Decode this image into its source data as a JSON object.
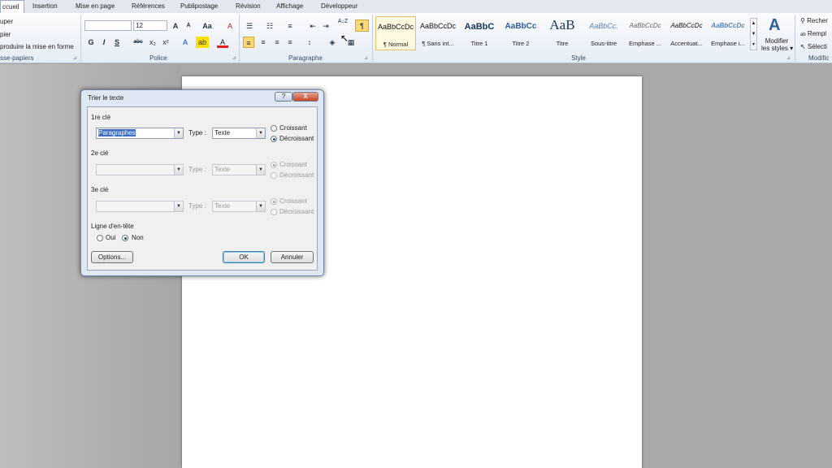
{
  "tabs": [
    "ccueil",
    "Insertion",
    "Mise en page",
    "Références",
    "Publipostage",
    "Révision",
    "Affichage",
    "Développeur"
  ],
  "clipboard": {
    "items": [
      "uper",
      "pier",
      "produire la mise en forme"
    ],
    "label": "sse-papiers"
  },
  "font": {
    "name_value": "",
    "size_value": "12",
    "grow": "A",
    "shrink": "A",
    "case": "Aa",
    "clear": "A",
    "bold": "G",
    "italic": "I",
    "underline": "S",
    "strike": "abc",
    "sub": "x₂",
    "sup": "x²",
    "effects": "A",
    "highlight": "ab",
    "color": "A",
    "label": "Police"
  },
  "paragraph": {
    "label": "Paragraphe",
    "sort": "A↓Z",
    "show_marks": "¶"
  },
  "styles": {
    "label": "Style",
    "items": [
      {
        "sample": "AaBbCcDc",
        "name": "¶ Normal"
      },
      {
        "sample": "AaBbCcDc",
        "name": "¶ Sans int..."
      },
      {
        "sample": "AaBbC",
        "name": "Titre 1"
      },
      {
        "sample": "AaBbCc",
        "name": "Titre 2"
      },
      {
        "sample": "AaB",
        "name": "Titre"
      },
      {
        "sample": "AaBbCc.",
        "name": "Sous-titre"
      },
      {
        "sample": "AaBbCcDc",
        "name": "Emphase ..."
      },
      {
        "sample": "AaBbCcDc",
        "name": "Accentuat..."
      },
      {
        "sample": "AaBbCcDc",
        "name": "Emphase i..."
      }
    ],
    "modify_line1": "Modifier",
    "modify_line2": "les styles ▾"
  },
  "editing": {
    "find": "Recher",
    "replace": "Rempl",
    "select": "Sélecti",
    "label": "Modific"
  },
  "dialog": {
    "title": "Trier le texte",
    "help": "?",
    "close": "X",
    "key1": {
      "label": "1re clé",
      "field": "Paragraphes",
      "type_label": "Type :",
      "type_value": "Texte",
      "asc": "Croissant",
      "desc": "Décroissant"
    },
    "key2": {
      "label": "2e clé",
      "field": "",
      "type_label": "Type :",
      "type_value": "Texte",
      "asc": "Croissant",
      "desc": "Décroissant"
    },
    "key3": {
      "label": "3e clé",
      "field": "",
      "type_label": "Type :",
      "type_value": "Texte",
      "asc": "Croissant",
      "desc": "Décroissant"
    },
    "header": {
      "label": "Ligne d'en-tête",
      "yes": "Oui",
      "no": "Non"
    },
    "options": "Options...",
    "ok": "OK",
    "cancel": "Annuler"
  }
}
